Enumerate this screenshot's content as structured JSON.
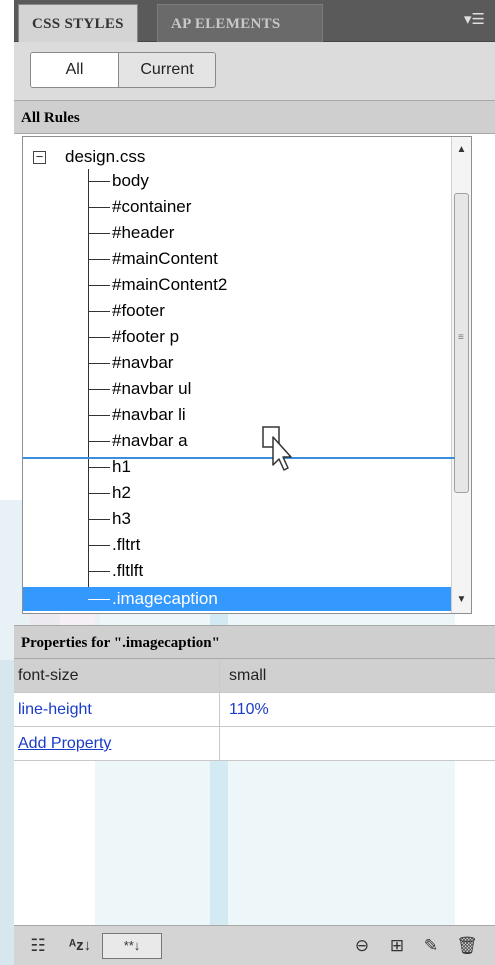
{
  "tabs": [
    {
      "label": "CSS STYLES",
      "active": true
    },
    {
      "label": "AP ELEMENTS",
      "active": false
    }
  ],
  "panel_menu_icon": "panel-menu-icon",
  "toggle": {
    "all_label": "All",
    "current_label": "Current",
    "selected": "All"
  },
  "all_rules": {
    "header": "All Rules",
    "stylesheet": "design.css",
    "rules": [
      "body",
      "#container",
      "#header",
      "#mainContent",
      "#mainContent2",
      "#footer",
      "#footer p",
      "#navbar",
      "#navbar ul",
      "#navbar li",
      "#navbar a",
      "h1",
      "h2",
      "h3",
      ".fltrt",
      ".fltlft",
      ".imagecaption"
    ],
    "selected_rule": ".imagecaption"
  },
  "properties": {
    "header": "Properties for \".imagecaption\"",
    "rows": [
      {
        "name": "font-size",
        "value": "small"
      },
      {
        "name": "line-height",
        "value": "110%"
      }
    ],
    "add_label": "Add Property"
  },
  "toolbar_icons": [
    "list-view-icon",
    "sort-az-icon",
    "show-set-properties-icon",
    "attach-style-sheet-icon",
    "new-css-rule-icon",
    "edit-rule-icon",
    "delete-icon"
  ],
  "colors": {
    "selection": "#3399ff",
    "link": "#1a3cc8",
    "drop_line": "#3b8edc",
    "tab_bar": "#5a5a5a"
  }
}
